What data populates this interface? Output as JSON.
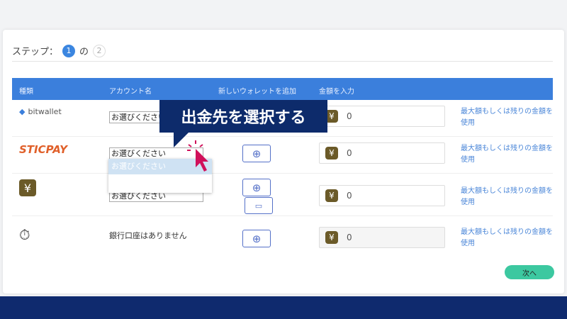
{
  "steps": {
    "label": "ステップ：",
    "current": "1",
    "of": "の",
    "total": "2"
  },
  "table": {
    "headers": [
      "種類",
      "アカウント名",
      "新しいウォレットを追加",
      "金額を入力"
    ],
    "rows": [
      {
        "type": "bitwallet",
        "account": "お選びください",
        "amount": "0",
        "link": "最大額もしくは残りの金額を使用"
      },
      {
        "type": "STICPAY",
        "account": "お選びください",
        "amount": "0",
        "link": "最大額もしくは残りの金額を使用"
      },
      {
        "type": "¥",
        "account": "お選びください",
        "amount": "0",
        "link": "最大額もしくは残りの金額を使用"
      },
      {
        "type": "bank",
        "account": "銀行口座はありません",
        "amount": "0",
        "link": "最大額もしくは残りの金額を使用"
      }
    ]
  },
  "dropdown": {
    "options": [
      "お選びください",
      ""
    ]
  },
  "callout": "出金先を選択する",
  "next_label": "次へ",
  "icons": {
    "add": "⊕",
    "yen": "¥",
    "wallet": "wallet-icon"
  },
  "colors": {
    "header": "#3b7fdc",
    "callout": "#0d2b6b",
    "next": "#3cc8a0",
    "cursor": "#d0105a"
  }
}
